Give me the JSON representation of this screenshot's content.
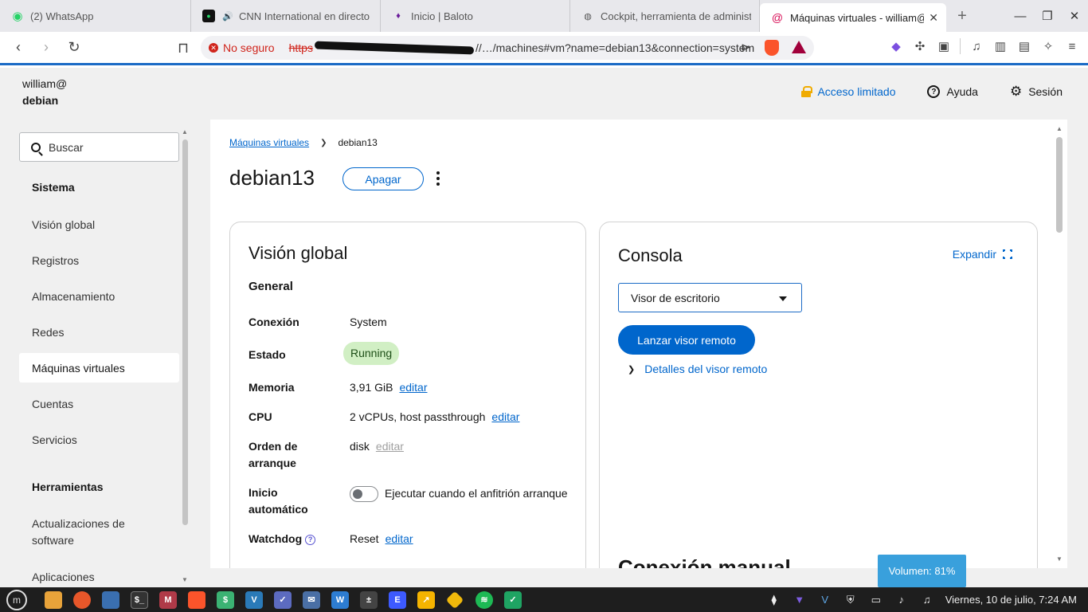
{
  "browser": {
    "tabs": [
      {
        "title": "(2) WhatsApp",
        "icon": "whatsapp-icon",
        "color": "#25d366"
      },
      {
        "title": "CNN International en directo",
        "icon": "cnn-icon",
        "color": "#111111"
      },
      {
        "title": "Inicio | Baloto",
        "icon": "baloto-icon",
        "color": "#6a1b9a"
      },
      {
        "title": "Cockpit, herramienta de administración",
        "icon": "globe-icon",
        "color": "#555555"
      },
      {
        "title": "Máquinas virtuales - william@",
        "icon": "debian-icon",
        "color": "#d70a53",
        "active": true
      }
    ],
    "address": {
      "security_label": "No seguro",
      "scheme": "https",
      "url_visible": "//…/machines#vm?name=debian13&connection=system"
    }
  },
  "cockpit": {
    "user": "william@",
    "host": "debian",
    "top_actions": {
      "limited": "Acceso limitado",
      "help": "Ayuda",
      "session": "Sesión"
    },
    "search_placeholder": "Buscar",
    "nav": {
      "system_header": "Sistema",
      "items": [
        "Visión global",
        "Registros",
        "Almacenamiento",
        "Redes",
        "Máquinas virtuales",
        "Cuentas",
        "Servicios"
      ],
      "active": "Máquinas virtuales",
      "tools_header": "Herramientas",
      "tools": [
        "Actualizaciones de software",
        "Aplicaciones"
      ]
    },
    "breadcrumb": {
      "parent": "Máquinas virtuales",
      "current": "debian13"
    },
    "vm": {
      "name": "debian13",
      "shutdown_button": "Apagar"
    },
    "overview": {
      "title": "Visión global",
      "subtitle": "General",
      "rows": {
        "connection": {
          "label": "Conexión",
          "value": "System"
        },
        "state": {
          "label": "Estado",
          "value": "Running"
        },
        "memory": {
          "label": "Memoria",
          "value": "3,91 GiB",
          "action": "editar"
        },
        "cpu": {
          "label": "CPU",
          "value": "2 vCPUs, host passthrough",
          "action": "editar"
        },
        "boot": {
          "label": "Orden de arranque",
          "value": "disk",
          "action": "editar"
        },
        "autostart": {
          "label": "Inicio automático",
          "value": "Ejecutar cuando el anfitrión arranque"
        },
        "watchdog": {
          "label": "Watchdog",
          "value": "Reset",
          "action": "editar"
        }
      }
    },
    "console": {
      "title": "Consola",
      "expand": "Expandir",
      "viewer_select": "Visor de escritorio",
      "launch_button": "Lanzar visor remoto",
      "details_toggle": "Detalles del visor remoto",
      "manual_heading": "Conexión manual"
    }
  },
  "osd": {
    "volume": "Volumen: 81%"
  },
  "taskbar": {
    "clock": "Viernes, 10 de julio, 7:24 AM"
  },
  "colors": {
    "accent": "#0066cc",
    "running_badge_bg": "#d1efc4",
    "warning": "#f0ab00",
    "insecure_red": "#d0241b"
  }
}
